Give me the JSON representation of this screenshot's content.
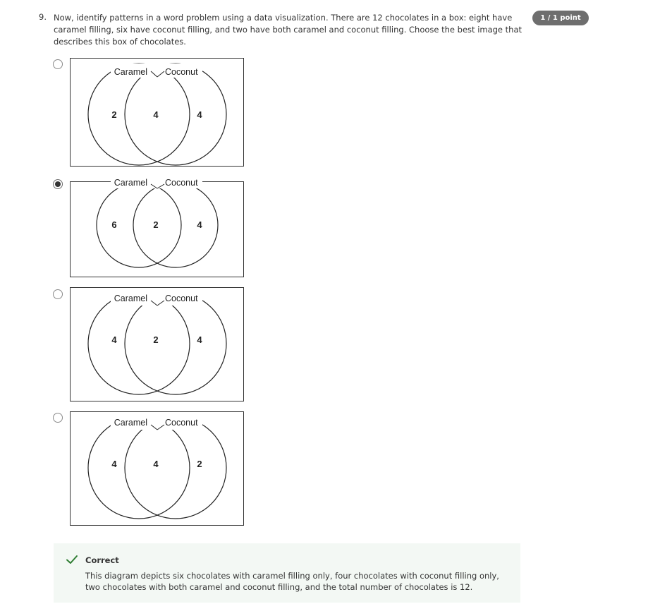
{
  "question": {
    "number": "9.",
    "text": "Now, identify patterns in a word problem using a data visualization. There are 12 chocolates in a box: eight have caramel filling, six have coconut filling, and two have both caramel and coconut filling. Choose the best image that describes this box of chocolates.",
    "points": "1 / 1 point"
  },
  "options": [
    {
      "left_label": "Caramel",
      "right_label": "Coconut",
      "left_only": "2",
      "both": "4",
      "right_only": "4",
      "selected": false
    },
    {
      "left_label": "Caramel",
      "right_label": "Coconut",
      "left_only": "6",
      "both": "2",
      "right_only": "4",
      "selected": true
    },
    {
      "left_label": "Caramel",
      "right_label": "Coconut",
      "left_only": "4",
      "both": "2",
      "right_only": "4",
      "selected": false
    },
    {
      "left_label": "Caramel",
      "right_label": "Coconut",
      "left_only": "4",
      "both": "4",
      "right_only": "2",
      "selected": false
    }
  ],
  "feedback": {
    "icon": "check-icon",
    "status": "Correct",
    "text": "This diagram depicts six chocolates with caramel filling only, four chocolates with coconut filling only, two chocolates with both caramel and coconut filling, and the total number of chocolates is 12.",
    "accent_color": "#2e7d32"
  }
}
